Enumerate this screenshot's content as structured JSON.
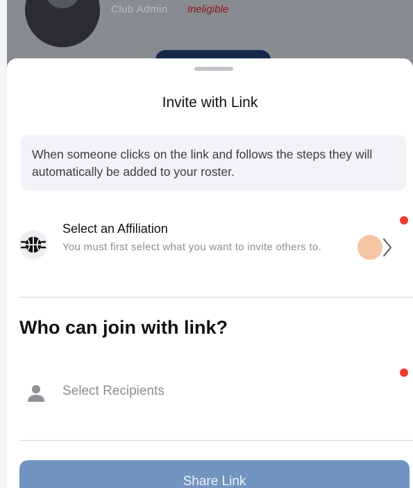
{
  "background_screen": {
    "role_text": "Club Admin",
    "status_text": "Ineligible"
  },
  "sheet": {
    "title": "Invite with Link",
    "info_text": "When someone clicks on the link and follows the steps they will automatically be added to your roster."
  },
  "affiliation": {
    "title": "Select an Affiliation",
    "subtitle": "You must first select what you want to invite others to.",
    "icon": "basketball-icon"
  },
  "join_section": {
    "heading": "Who can join with link?"
  },
  "recipients": {
    "placeholder": "Select Recipients",
    "icon": "person-icon"
  },
  "share_button": {
    "label": "Share Link"
  },
  "colors": {
    "required_dot": "#ee3b30",
    "share_button": "#7294c0",
    "touch_indicator": "#f6c6a4"
  }
}
